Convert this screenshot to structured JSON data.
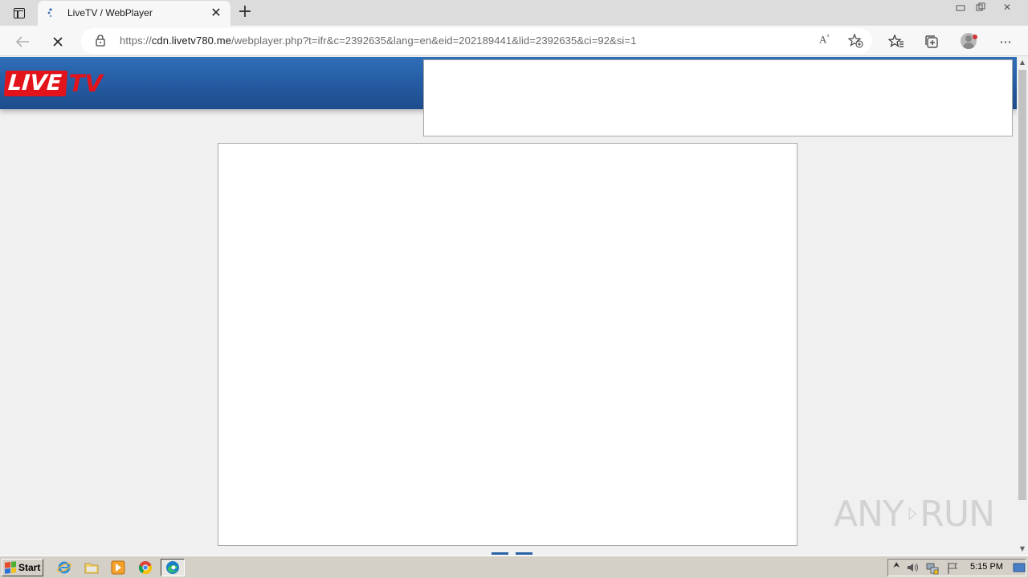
{
  "browser": {
    "tab": {
      "title": "LiveTV / WebPlayer",
      "close": "✕"
    },
    "newtab": "+",
    "window_controls": {
      "minimize": "▭",
      "restore": "⧉",
      "close": "✕"
    },
    "nav": {
      "back": "←",
      "stop": "✕"
    },
    "address": {
      "scheme": "https://",
      "host": "cdn.livetv780.me",
      "path": "/webplayer.php?t=ifr&c=2392635&lang=en&eid=202189441&lid=2392635&ci=92&si=1"
    },
    "read_aloud": "Aᵀ",
    "toolbar": {
      "favorites": "☆",
      "collections": "⧉",
      "more": "···"
    }
  },
  "site": {
    "logo": {
      "live": "LIVE",
      "tv": "TV"
    }
  },
  "watermark": {
    "left": "ANY",
    "right": "RUN"
  },
  "taskbar": {
    "start_label": "Start",
    "clock": "5:15 PM"
  }
}
